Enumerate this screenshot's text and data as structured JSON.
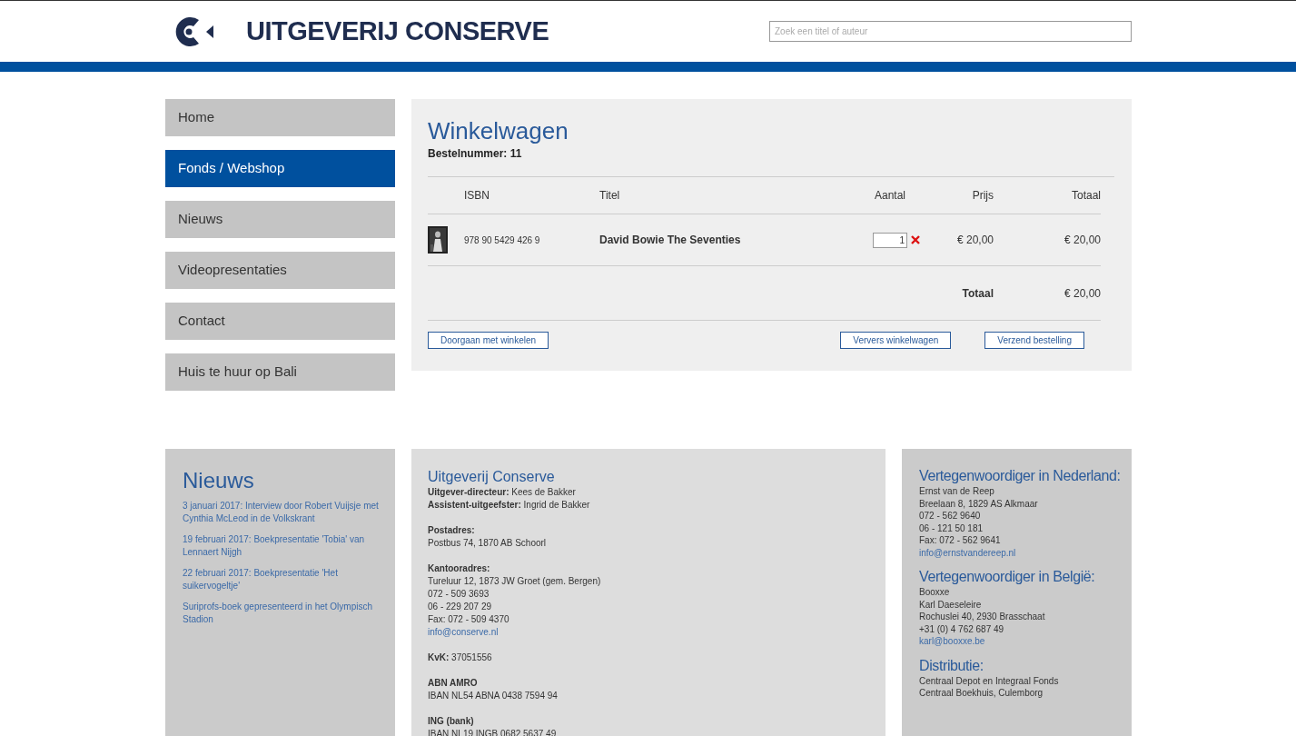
{
  "header": {
    "logo_text": "UITGEVERIJ CONSERVE",
    "search": {
      "placeholder": "Zoek een titel of auteur"
    }
  },
  "nav": [
    {
      "label": "Home",
      "selected": false
    },
    {
      "label": "Fonds / Webshop",
      "selected": true
    },
    {
      "label": "Nieuws",
      "selected": false
    },
    {
      "label": "Videopresentaties",
      "selected": false
    },
    {
      "label": "Contact",
      "selected": false
    },
    {
      "label": "Huis te huur op Bali",
      "selected": false
    }
  ],
  "cart": {
    "title": "Winkelwagen",
    "order_number": "Bestelnummer: 11",
    "columns": [
      "ISBN",
      "Titel",
      "Aantal",
      "Prijs",
      "Totaal"
    ],
    "rows": [
      {
        "isbn": "978 90 5429 426 9",
        "title": "David Bowie The Seventies",
        "quantity": "1",
        "price": "€ 20,00",
        "total": "€ 20,00"
      }
    ],
    "total_label": "Totaal",
    "total_value": "€ 20,00",
    "buttons": [
      "Doorgaan met winkelen",
      "Ververs winkelwagen",
      "Verzend bestelling"
    ]
  },
  "footer": {
    "news": {
      "title": "Nieuws",
      "items": [
        "3 januari 2017: Interview door Robert Vuijsje met Cynthia McLeod in de Volkskrant",
        "19 februari 2017: Boekpresentatie 'Tobia' van Lennaert Nijgh",
        "22 februari 2017: Boekpresentatie 'Het suikervogeltje'",
        "Suriprofs-boek gepresenteerd in het Olympisch Stadion"
      ]
    },
    "contact": {
      "title": "Uitgeverij Conserve",
      "blocks": [
        [
          {
            "kind": "text",
            "text": "**Uitgever-directeur:** Kees de Bakker"
          },
          {
            "kind": "text",
            "text": "**Assistent-uitgeefster:** Ingrid de Bakker"
          }
        ],
        [
          {
            "kind": "text",
            "text": "**Postadres:**"
          },
          {
            "kind": "text",
            "text": "Postbus 74, 1870 AB Schoorl"
          }
        ],
        [
          {
            "kind": "text",
            "text": "**Kantooradres:**"
          },
          {
            "kind": "text",
            "text": "Tureluur 12, 1873 JW Groet (gem. Bergen)"
          },
          {
            "kind": "text",
            "text": "072 - 509 3693"
          },
          {
            "kind": "text",
            "text": "06 - 229 207 29"
          },
          {
            "kind": "text",
            "text": "Fax: 072 - 509 4370"
          },
          {
            "kind": "link",
            "text": "info@conserve.nl"
          }
        ],
        [
          {
            "kind": "text",
            "text": "**KvK:** 37051556"
          }
        ],
        [
          {
            "kind": "text",
            "text": "**ABN AMRO**"
          },
          {
            "kind": "text",
            "text": "IBAN NL54 ABNA 0438 7594 94"
          }
        ],
        [
          {
            "kind": "text",
            "text": "**ING (bank)**"
          },
          {
            "kind": "text",
            "text": "IBAN NL19 INGB 0682 5637 49"
          }
        ]
      ]
    },
    "reps": [
      {
        "title": "Vertegenwoordiger in Nederland:",
        "lines": [
          {
            "kind": "text",
            "text": "Ernst van de Reep"
          },
          {
            "kind": "text",
            "text": "Breelaan 8, 1829 AS Alkmaar"
          },
          {
            "kind": "text",
            "text": "072 - 562 9640"
          },
          {
            "kind": "text",
            "text": "06 - 121 50 181"
          },
          {
            "kind": "text",
            "text": "Fax: 072 - 562 9641"
          },
          {
            "kind": "link",
            "text": "info@ernstvandereep.nl"
          }
        ]
      },
      {
        "title": "Vertegenwoordiger in België:",
        "lines": [
          {
            "kind": "text",
            "text": "Booxxe"
          },
          {
            "kind": "text",
            "text": "Karl Daeseleire"
          },
          {
            "kind": "text",
            "text": "Rochuslei 40, 2930 Brasschaat"
          },
          {
            "kind": "text",
            "text": "+31 (0) 4 762 687 49"
          },
          {
            "kind": "link",
            "text": "karl@booxxe.be"
          }
        ]
      },
      {
        "title": "Distributie:",
        "lines": [
          {
            "kind": "text",
            "text": "Centraal Depot en Integraal Fonds"
          },
          {
            "kind": "text",
            "text": "Centraal Boekhuis, Culemborg"
          }
        ]
      }
    ]
  }
}
